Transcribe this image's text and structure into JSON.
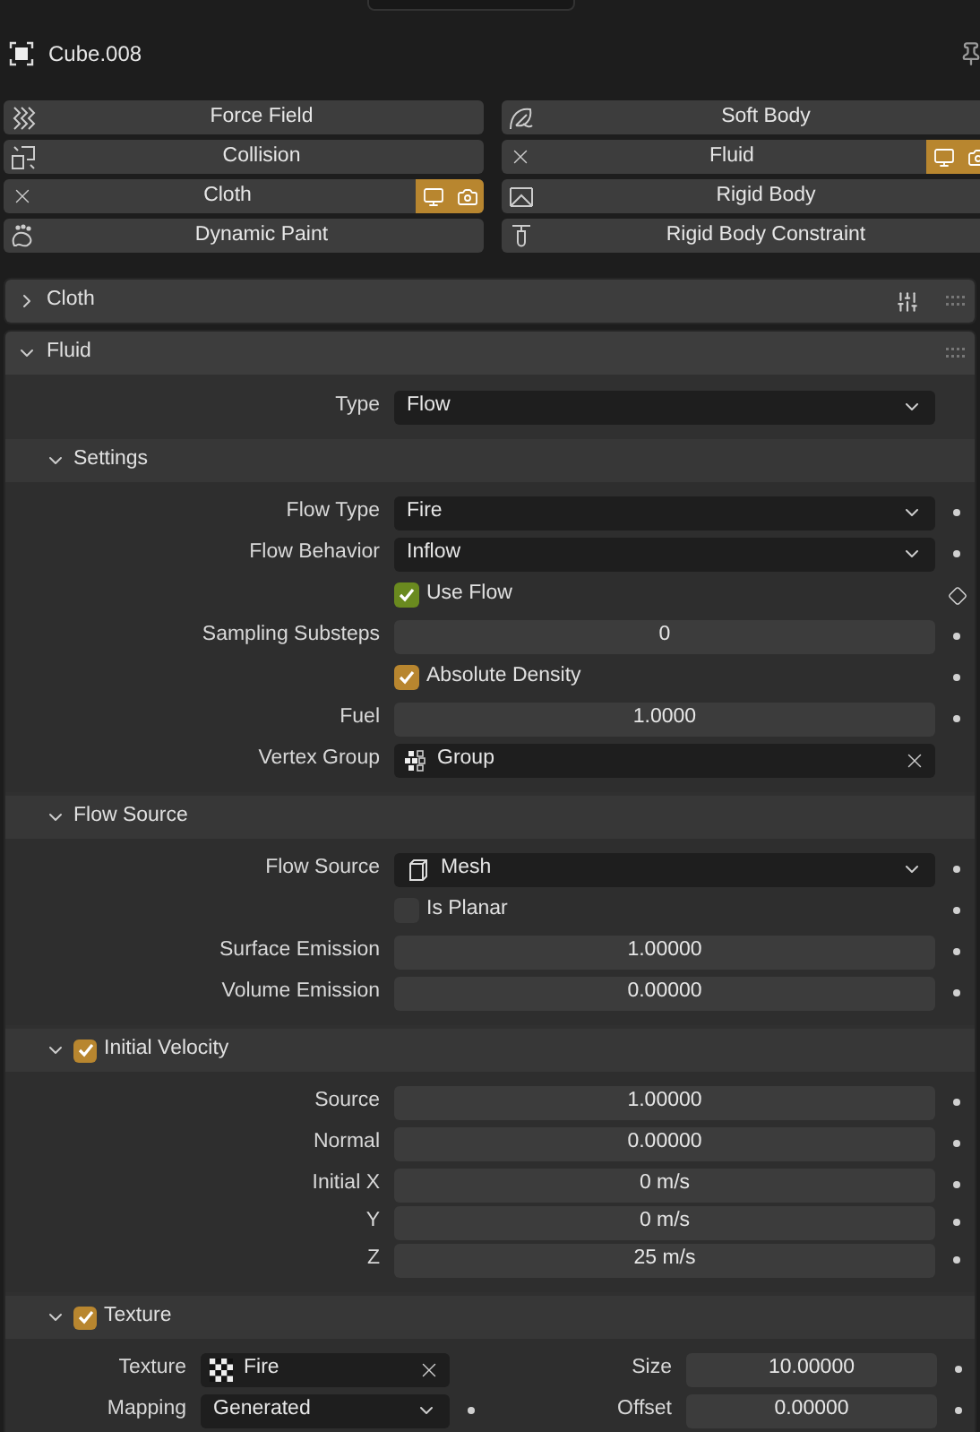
{
  "object": {
    "name": "Cube.008"
  },
  "physics_buttons": [
    {
      "label": "Force Field",
      "enabled": false
    },
    {
      "label": "Soft Body",
      "enabled": false
    },
    {
      "label": "Collision",
      "enabled": false
    },
    {
      "label": "Fluid",
      "enabled": true,
      "show_viewport": true,
      "show_render": true
    },
    {
      "label": "Cloth",
      "enabled": true,
      "show_viewport": true,
      "show_render": true
    },
    {
      "label": "Rigid Body",
      "enabled": false
    },
    {
      "label": "Dynamic Paint",
      "enabled": false
    },
    {
      "label": "Rigid Body Constraint",
      "enabled": false
    }
  ],
  "panels": [
    {
      "title": "Cloth",
      "expanded": false
    },
    {
      "title": "Fluid",
      "expanded": true,
      "rows": [
        {
          "kind": "dropdown",
          "label": "Type",
          "value": "Flow"
        }
      ],
      "subpanels": [
        {
          "title": "Settings",
          "expanded": true,
          "rows": [
            {
              "kind": "dropdown",
              "label": "Flow Type",
              "value": "Fire",
              "animatable": true
            },
            {
              "kind": "dropdown",
              "label": "Flow Behavior",
              "value": "Inflow",
              "animatable": true
            },
            {
              "kind": "checkbox",
              "label": "Use Flow",
              "checked": true,
              "color": "#6a8a1f",
              "keyframe": true
            },
            {
              "kind": "number",
              "label": "Sampling Substeps",
              "value": "0",
              "animatable": true
            },
            {
              "kind": "checkbox",
              "label": "Absolute Density",
              "checked": true,
              "color": "#b8862f",
              "animatable": true
            },
            {
              "kind": "number",
              "label": "Fuel",
              "value": "1.0000",
              "animatable": true
            },
            {
              "kind": "picker",
              "label": "Vertex Group",
              "value": "Group"
            }
          ]
        },
        {
          "title": "Flow Source",
          "expanded": true,
          "rows": [
            {
              "kind": "iconmenu",
              "label": "Flow Source",
              "value": "Mesh",
              "animatable": true
            },
            {
              "kind": "checkbox",
              "label": "Is Planar",
              "checked": false,
              "animatable": true
            },
            {
              "kind": "number",
              "label": "Surface Emission",
              "value": "1.00000",
              "animatable": true
            },
            {
              "kind": "number",
              "label": "Volume Emission",
              "value": "0.00000",
              "animatable": true
            }
          ]
        },
        {
          "title": "Initial Velocity",
          "expanded": true,
          "checked": true,
          "rows": [
            {
              "kind": "number",
              "label": "Source",
              "value": "1.00000",
              "animatable": true
            },
            {
              "kind": "number",
              "label": "Normal",
              "value": "0.00000",
              "animatable": true
            },
            {
              "kind": "stack",
              "rows": [
                {
                  "label": "Initial X",
                  "value": "0 m/s",
                  "animatable": true
                },
                {
                  "label": "Y",
                  "value": "0 m/s",
                  "animatable": true
                },
                {
                  "label": "Z",
                  "value": "25 m/s",
                  "animatable": true
                }
              ]
            }
          ]
        },
        {
          "title": "Texture",
          "expanded": true,
          "checked": true,
          "columns": [
            [
              {
                "kind": "texture",
                "label": "Texture",
                "value": "Fire"
              },
              {
                "kind": "dropdown",
                "label": "Mapping",
                "value": "Generated",
                "animatable": true
              }
            ],
            [
              {
                "kind": "number",
                "label": "Size",
                "value": "10.00000",
                "animatable": true
              },
              {
                "kind": "number",
                "label": "Offset",
                "value": "0.00000",
                "animatable": true
              }
            ]
          ]
        }
      ]
    }
  ]
}
